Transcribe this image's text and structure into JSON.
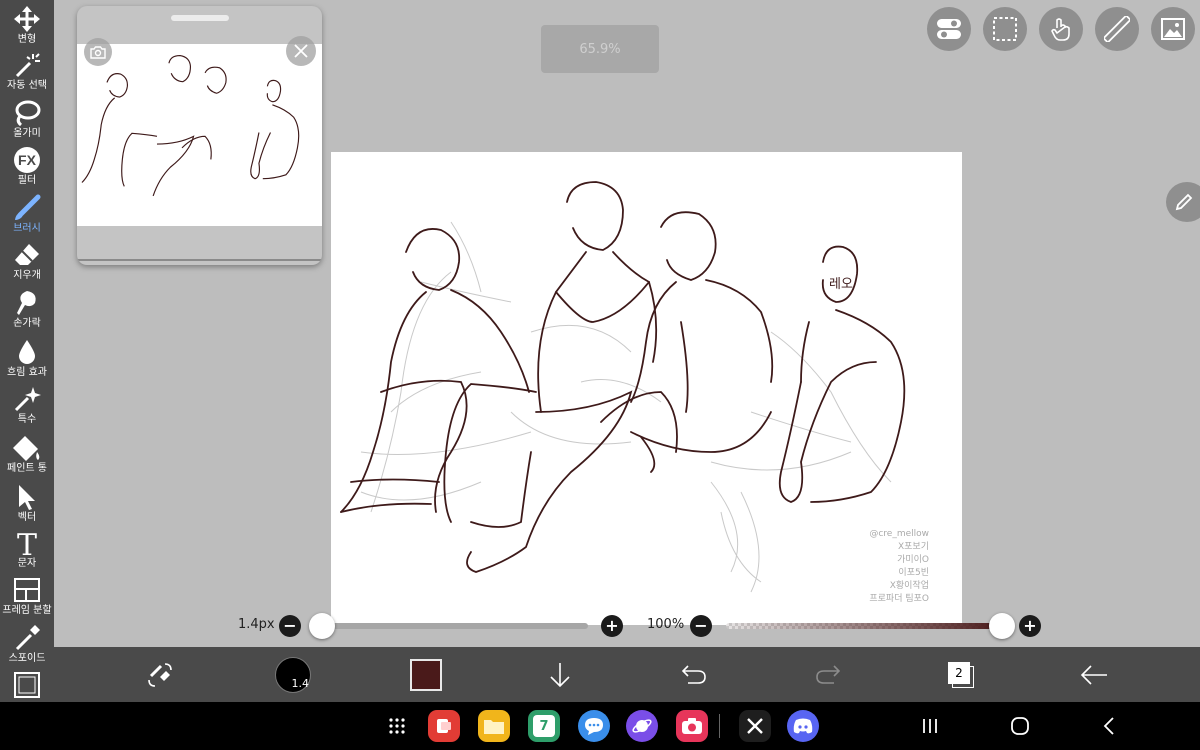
{
  "tools": [
    {
      "id": "transform",
      "label": "변형",
      "icon": "move-arrows-icon"
    },
    {
      "id": "magic-wand",
      "label": "자동 선택",
      "icon": "magic-wand-icon"
    },
    {
      "id": "lasso",
      "label": "올가미",
      "icon": "lasso-icon"
    },
    {
      "id": "filter",
      "label": "필터",
      "icon": "fx-icon"
    },
    {
      "id": "brush",
      "label": "브러시",
      "icon": "brush-icon",
      "active": true
    },
    {
      "id": "eraser",
      "label": "지우개",
      "icon": "eraser-icon"
    },
    {
      "id": "smudge",
      "label": "손가락",
      "icon": "finger-icon"
    },
    {
      "id": "blur",
      "label": "흐림 효과",
      "icon": "drop-icon"
    },
    {
      "id": "special",
      "label": "특수",
      "icon": "sparkle-wand-icon"
    },
    {
      "id": "bucket",
      "label": "페인트 통",
      "icon": "paint-bucket-icon"
    },
    {
      "id": "vector",
      "label": "벡터",
      "icon": "pointer-arrow-icon"
    },
    {
      "id": "text",
      "label": "문자",
      "icon": "text-t-icon"
    },
    {
      "id": "frame",
      "label": "프레임 분할",
      "icon": "frame-divider-icon"
    },
    {
      "id": "eyedropper",
      "label": "스포이드",
      "icon": "eyedropper-icon"
    },
    {
      "id": "canvas",
      "label": "",
      "icon": "canvas-square-icon"
    }
  ],
  "zoom": {
    "label": "65.9%"
  },
  "brush_size": {
    "label": "1.4px",
    "value_fraction": 0.0
  },
  "opacity": {
    "label": "100%",
    "value_fraction": 1.0
  },
  "bottom": {
    "brush_size_badge": "1.4",
    "layers_count": "2",
    "color": "#4a1a1a"
  },
  "drawing": {
    "name_tag": "레오",
    "watermark_lines": [
      "@cre_mellow",
      "X포보기",
      "가미이O",
      "이포5빈",
      "X황이작업",
      "프로파더 팀포O"
    ]
  },
  "colors": {
    "accent": "#7db4ff",
    "line": "#3e1a1a",
    "sketch": "#c9c9c9"
  }
}
